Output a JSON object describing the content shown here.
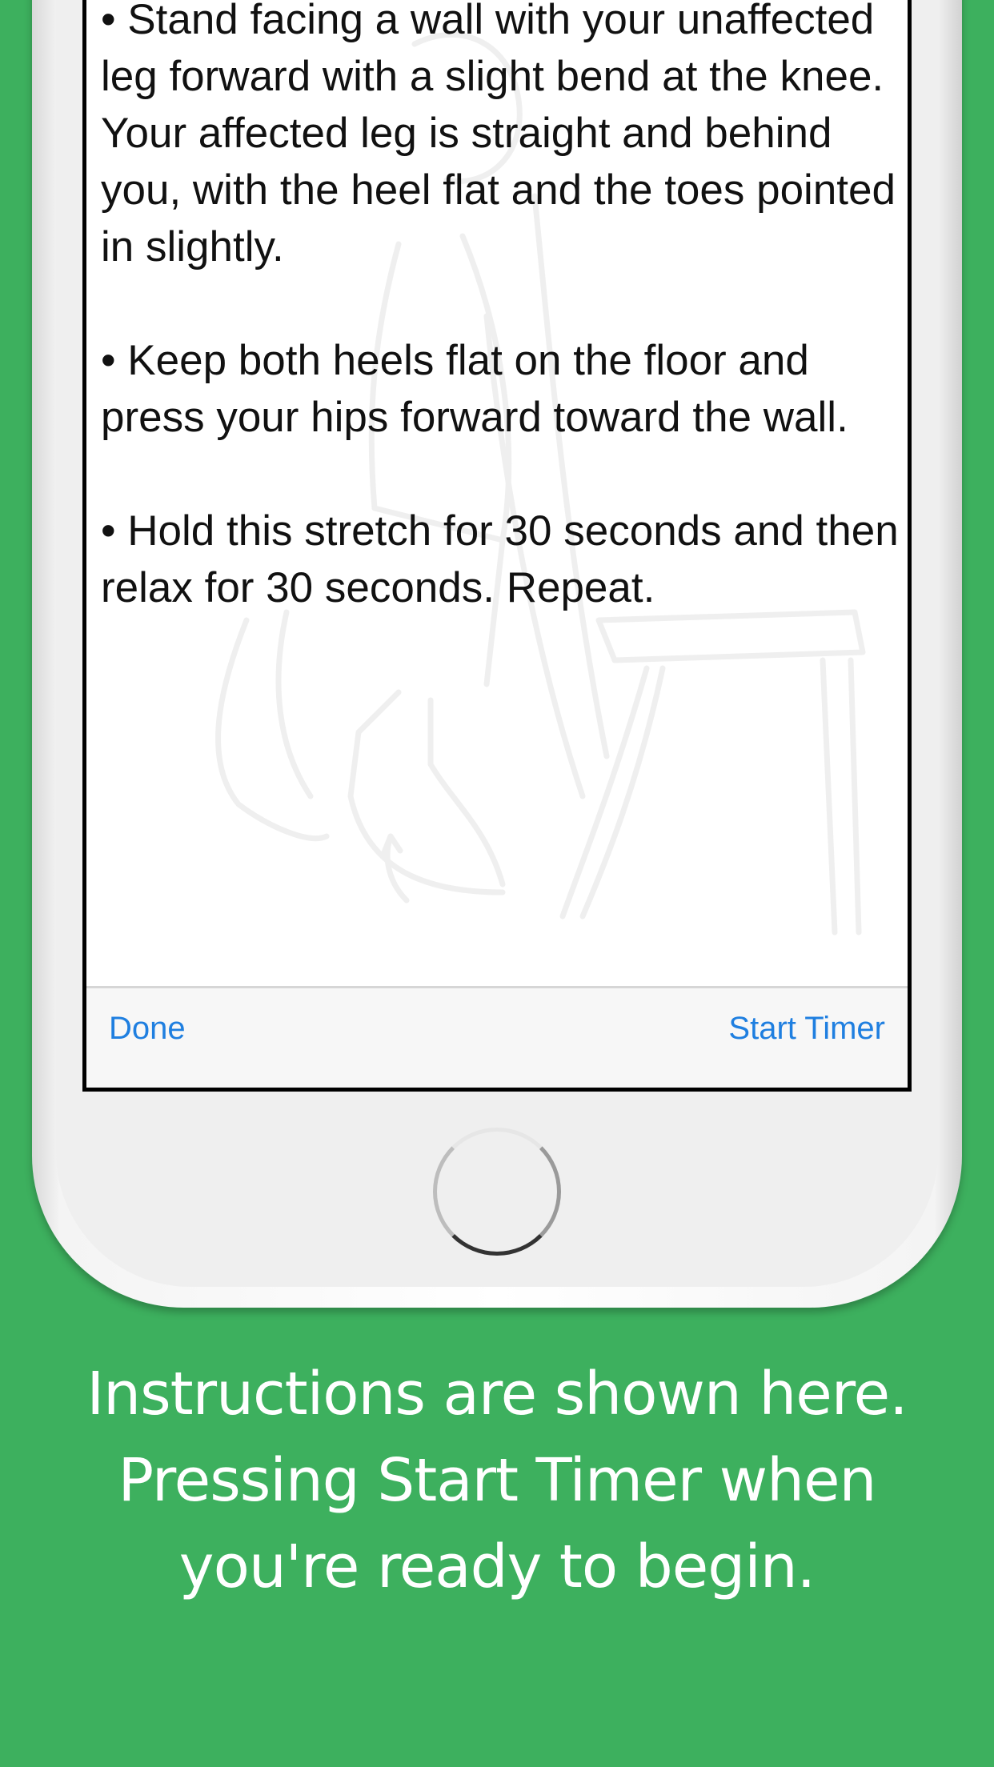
{
  "screen": {
    "instructions": [
      "• Stand facing a wall with your unaffected leg forward with a slight bend at the knee. Your affected leg is straight and behind you, with the heel flat and the toes pointed in slightly.",
      "• Keep both heels flat on the floor and press your hips forward toward the wall.",
      "• Hold this stretch for 30 seconds and then relax for 30 seconds. Repeat."
    ],
    "toolbar": {
      "done_label": "Done",
      "start_timer_label": "Start Timer"
    },
    "illustration": "woman-stretching-chair-icon"
  },
  "caption": {
    "lines": [
      "Instructions are shown here.",
      "Pressing Start Timer when",
      "you're ready to begin."
    ]
  },
  "colors": {
    "background": "#3db05e",
    "link": "#1f7fe0",
    "caption_text": "#ffffff"
  }
}
